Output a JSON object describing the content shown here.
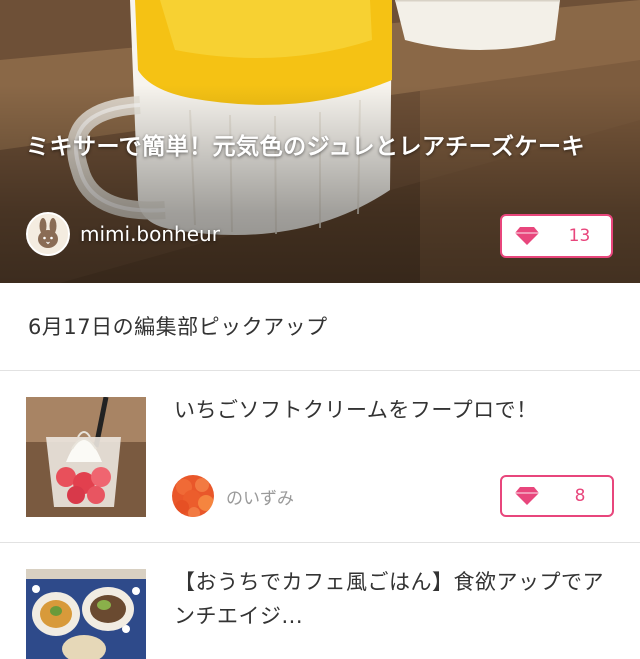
{
  "hero": {
    "title": "ミキサーで簡単！元気色のジュレとレアチーズケーキ",
    "author": "mimi.bonheur",
    "like_count": "13",
    "avatar_icon": "rabbit-avatar-icon"
  },
  "section": {
    "title": "6月17日の編集部ピックアップ"
  },
  "items": [
    {
      "title": "いちごソフトクリームをフープロで！",
      "author": "のいずみ",
      "like_count": "8"
    },
    {
      "title": "【おうちでカフェ風ごはん】食欲アップでアンチエイジ..."
    }
  ],
  "colors": {
    "accent": "#e8467c",
    "divider": "#e2e2e2",
    "muted_text": "#9a9a9a"
  }
}
